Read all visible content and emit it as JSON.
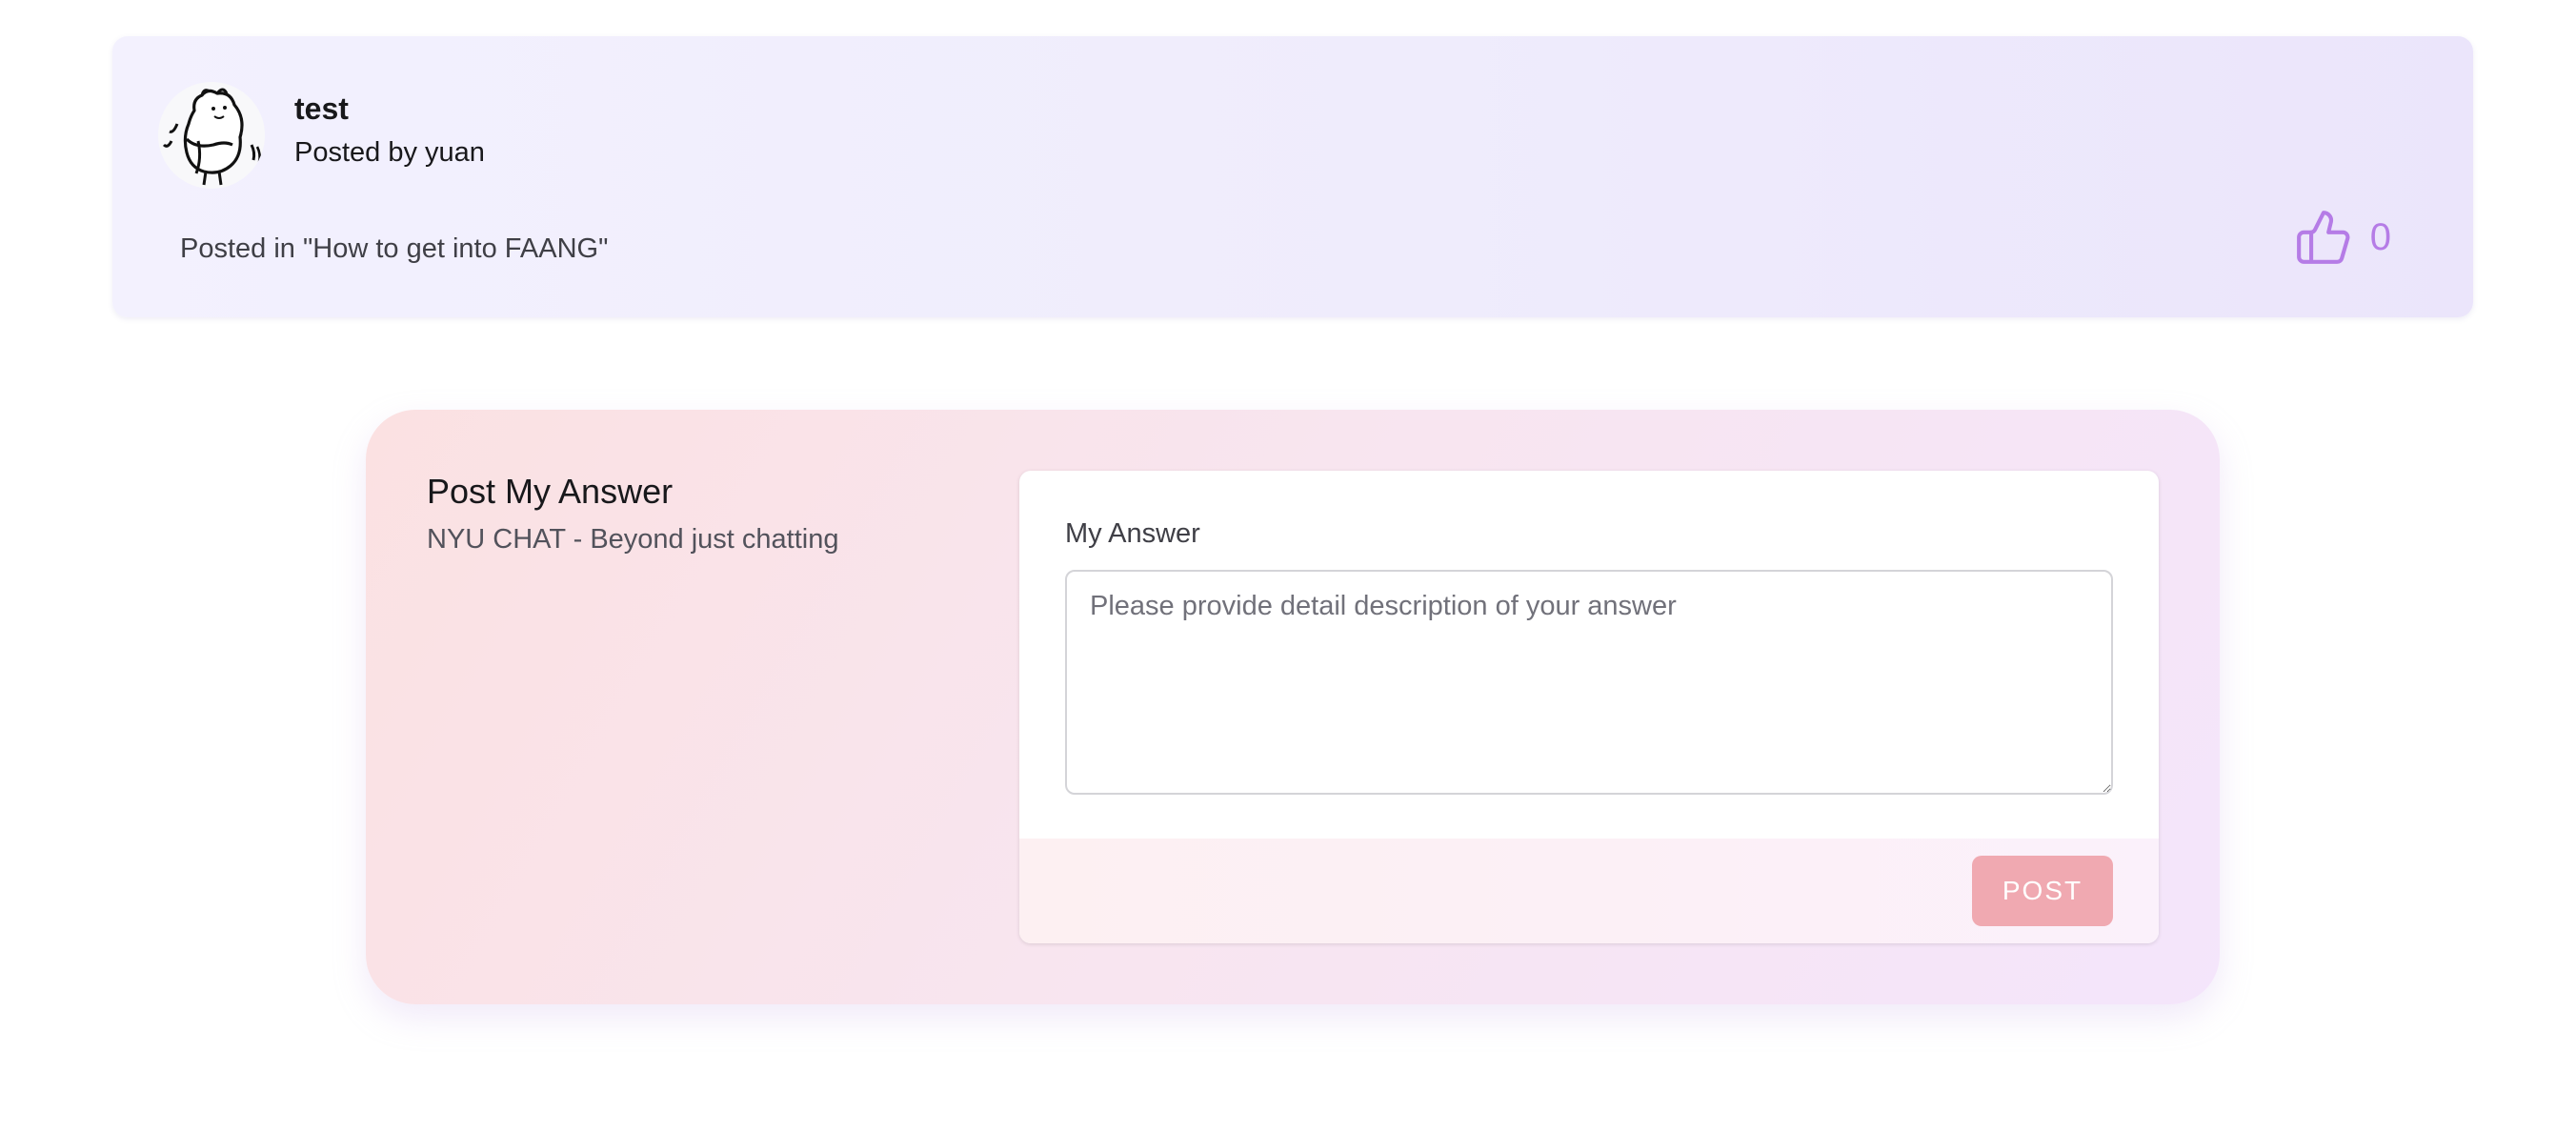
{
  "question": {
    "title": "test",
    "posted_by": "Posted by yuan",
    "posted_in": "Posted in \"How to get into FAANG\"",
    "avatar_icon": "cartoon-character-avatar",
    "like_icon": "thumbs-up-icon",
    "like_count": "0"
  },
  "answer_panel": {
    "title": "Post My Answer",
    "subtitle": "NYU CHAT - Beyond just chatting",
    "field_label": "My Answer",
    "textarea_value": "",
    "textarea_placeholder": "Please provide detail description of your answer",
    "post_button_label": "POST"
  },
  "colors": {
    "accent_purple": "#b57ce6",
    "post_button": "#f0a9b1",
    "question_card_bg": "#efecfc",
    "answer_panel_bg": "#f8e5ef"
  }
}
